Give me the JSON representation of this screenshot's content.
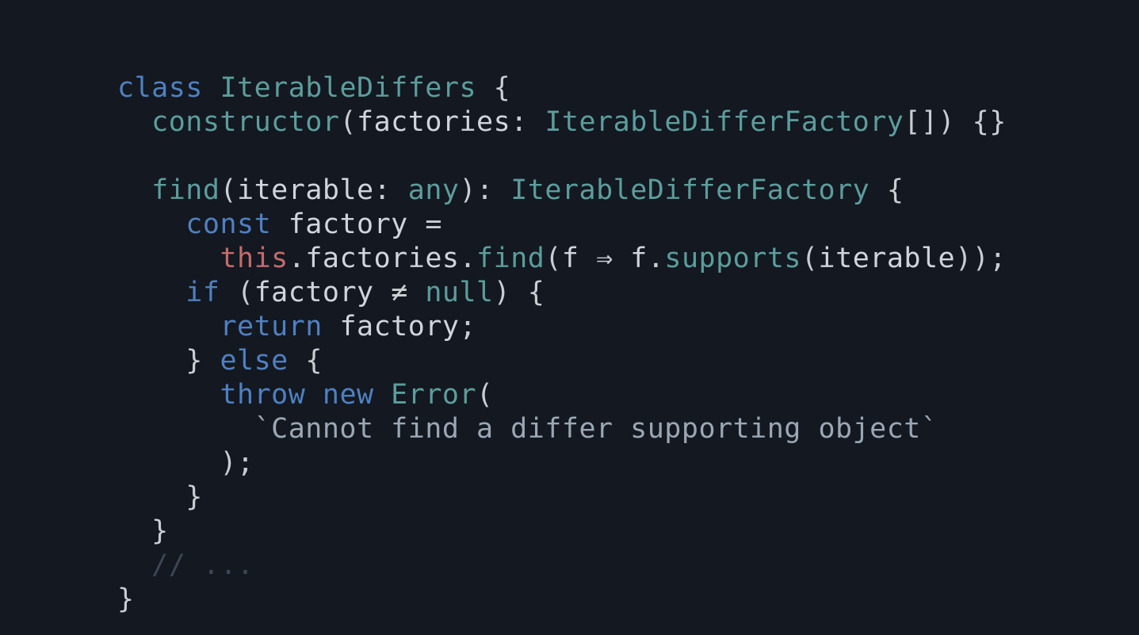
{
  "code": {
    "tokens": [
      {
        "cls": "tok-keyword",
        "t": "class"
      },
      {
        "cls": "tok-plain",
        "t": " "
      },
      {
        "cls": "tok-type",
        "t": "IterableDiffers"
      },
      {
        "cls": "tok-plain",
        "t": " "
      },
      {
        "cls": "tok-punct",
        "t": "{"
      },
      {
        "cls": null,
        "t": "\n"
      },
      {
        "cls": "tok-plain",
        "t": "  "
      },
      {
        "cls": "tok-fn",
        "t": "constructor"
      },
      {
        "cls": "tok-punct",
        "t": "("
      },
      {
        "cls": "tok-plain",
        "t": "factories"
      },
      {
        "cls": "tok-punct",
        "t": ":"
      },
      {
        "cls": "tok-plain",
        "t": " "
      },
      {
        "cls": "tok-type",
        "t": "IterableDifferFactory"
      },
      {
        "cls": "tok-punct",
        "t": "[]) {}"
      },
      {
        "cls": null,
        "t": "\n"
      },
      {
        "cls": null,
        "t": "\n"
      },
      {
        "cls": "tok-plain",
        "t": "  "
      },
      {
        "cls": "tok-fn",
        "t": "find"
      },
      {
        "cls": "tok-punct",
        "t": "("
      },
      {
        "cls": "tok-plain",
        "t": "iterable"
      },
      {
        "cls": "tok-punct",
        "t": ":"
      },
      {
        "cls": "tok-plain",
        "t": " "
      },
      {
        "cls": "tok-builtin",
        "t": "any"
      },
      {
        "cls": "tok-punct",
        "t": "):"
      },
      {
        "cls": "tok-plain",
        "t": " "
      },
      {
        "cls": "tok-type",
        "t": "IterableDifferFactory"
      },
      {
        "cls": "tok-plain",
        "t": " "
      },
      {
        "cls": "tok-punct",
        "t": "{"
      },
      {
        "cls": null,
        "t": "\n"
      },
      {
        "cls": "tok-plain",
        "t": "    "
      },
      {
        "cls": "tok-keyword",
        "t": "const"
      },
      {
        "cls": "tok-plain",
        "t": " factory "
      },
      {
        "cls": "tok-punct",
        "t": "="
      },
      {
        "cls": null,
        "t": "\n"
      },
      {
        "cls": "tok-plain",
        "t": "      "
      },
      {
        "cls": "tok-this",
        "t": "this"
      },
      {
        "cls": "tok-punct",
        "t": "."
      },
      {
        "cls": "tok-plain",
        "t": "factories"
      },
      {
        "cls": "tok-punct",
        "t": "."
      },
      {
        "cls": "tok-fn",
        "t": "find"
      },
      {
        "cls": "tok-punct",
        "t": "("
      },
      {
        "cls": "tok-plain",
        "t": "f "
      },
      {
        "cls": "tok-punct",
        "t": "⇒"
      },
      {
        "cls": "tok-plain",
        "t": " f"
      },
      {
        "cls": "tok-punct",
        "t": "."
      },
      {
        "cls": "tok-fn",
        "t": "supports"
      },
      {
        "cls": "tok-punct",
        "t": "("
      },
      {
        "cls": "tok-plain",
        "t": "iterable"
      },
      {
        "cls": "tok-punct",
        "t": "));"
      },
      {
        "cls": null,
        "t": "\n"
      },
      {
        "cls": "tok-plain",
        "t": "    "
      },
      {
        "cls": "tok-keyword",
        "t": "if"
      },
      {
        "cls": "tok-plain",
        "t": " "
      },
      {
        "cls": "tok-punct",
        "t": "("
      },
      {
        "cls": "tok-plain",
        "t": "factory "
      },
      {
        "cls": "tok-punct",
        "t": "≠"
      },
      {
        "cls": "tok-plain",
        "t": " "
      },
      {
        "cls": "tok-builtin",
        "t": "null"
      },
      {
        "cls": "tok-punct",
        "t": ") {"
      },
      {
        "cls": null,
        "t": "\n"
      },
      {
        "cls": "tok-plain",
        "t": "      "
      },
      {
        "cls": "tok-keyword",
        "t": "return"
      },
      {
        "cls": "tok-plain",
        "t": " factory"
      },
      {
        "cls": "tok-punct",
        "t": ";"
      },
      {
        "cls": null,
        "t": "\n"
      },
      {
        "cls": "tok-plain",
        "t": "    "
      },
      {
        "cls": "tok-punct",
        "t": "}"
      },
      {
        "cls": "tok-plain",
        "t": " "
      },
      {
        "cls": "tok-keyword",
        "t": "else"
      },
      {
        "cls": "tok-plain",
        "t": " "
      },
      {
        "cls": "tok-punct",
        "t": "{"
      },
      {
        "cls": null,
        "t": "\n"
      },
      {
        "cls": "tok-plain",
        "t": "      "
      },
      {
        "cls": "tok-keyword",
        "t": "throw"
      },
      {
        "cls": "tok-plain",
        "t": " "
      },
      {
        "cls": "tok-keyword",
        "t": "new"
      },
      {
        "cls": "tok-plain",
        "t": " "
      },
      {
        "cls": "tok-type",
        "t": "Error"
      },
      {
        "cls": "tok-punct",
        "t": "("
      },
      {
        "cls": null,
        "t": "\n"
      },
      {
        "cls": "tok-plain",
        "t": "        "
      },
      {
        "cls": "tok-string",
        "t": "`Cannot find a differ supporting object`"
      },
      {
        "cls": null,
        "t": "\n"
      },
      {
        "cls": "tok-plain",
        "t": "      "
      },
      {
        "cls": "tok-punct",
        "t": ");"
      },
      {
        "cls": null,
        "t": "\n"
      },
      {
        "cls": "tok-plain",
        "t": "    "
      },
      {
        "cls": "tok-punct",
        "t": "}"
      },
      {
        "cls": null,
        "t": "\n"
      },
      {
        "cls": "tok-plain",
        "t": "  "
      },
      {
        "cls": "tok-punct",
        "t": "}"
      },
      {
        "cls": null,
        "t": "\n"
      },
      {
        "cls": "tok-plain",
        "t": "  "
      },
      {
        "cls": "tok-comment",
        "t": "// ..."
      },
      {
        "cls": null,
        "t": "\n"
      },
      {
        "cls": "tok-punct",
        "t": "}"
      }
    ]
  }
}
